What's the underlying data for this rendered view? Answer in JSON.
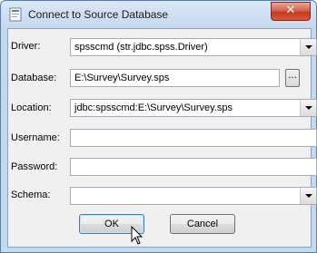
{
  "window": {
    "title": "Connect to Source Database",
    "close_glyph": "✕"
  },
  "form": {
    "driver": {
      "label": "Driver:",
      "value": "spsscmd  (str.jdbc.spss.Driver)"
    },
    "database": {
      "label": "Database:",
      "value": "E:\\Survey\\Survey.sps",
      "browse_glyph": "..."
    },
    "location": {
      "label": "Location:",
      "value": "jdbc:spsscmd:E:\\Survey\\Survey.sps"
    },
    "username": {
      "label": "Username:",
      "value": ""
    },
    "password": {
      "label": "Password:",
      "value": ""
    },
    "schema": {
      "label": "Schema:",
      "value": ""
    }
  },
  "buttons": {
    "ok": "OK",
    "cancel": "Cancel"
  },
  "icons": {
    "app": "database-window-icon",
    "cursor": "mouse-pointer-icon"
  },
  "colors": {
    "frame": "#c4d8ee",
    "client": "#f0f0f0",
    "close_button": "#c43b22",
    "default_button_border": "#3c7fb1"
  }
}
